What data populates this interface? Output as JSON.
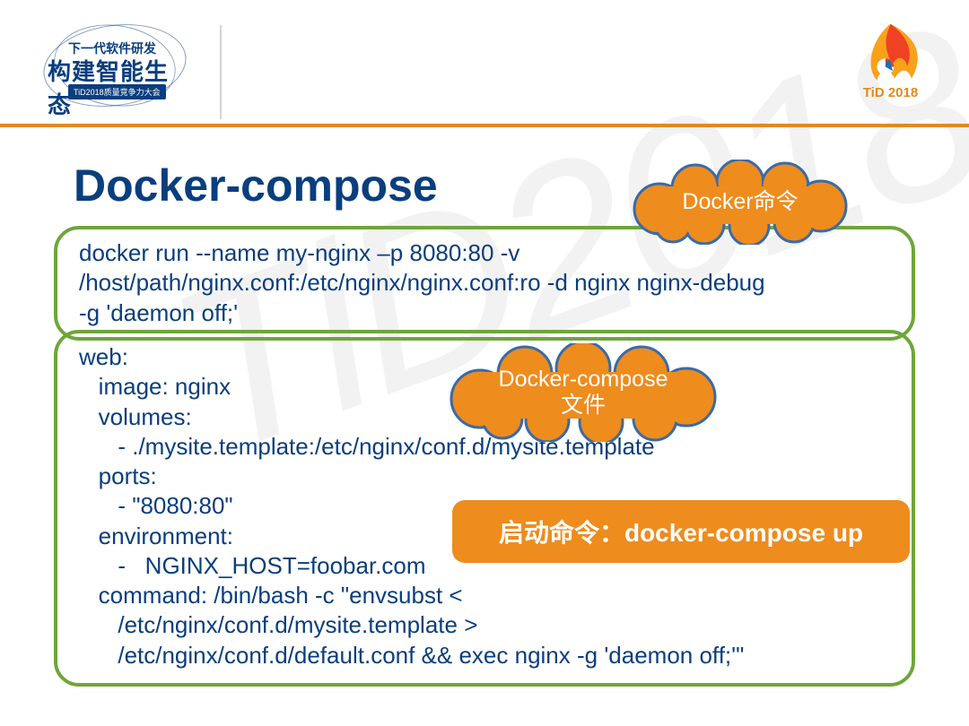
{
  "watermark": "TiD2018",
  "header": {
    "logo_top": "下一代软件研发",
    "logo_main": "构建智能生态",
    "logo_ribbon": "TiD2018质量竞争力大会",
    "tid_label": "TiD 2018"
  },
  "title": "Docker-compose",
  "cloud1": "Docker命令",
  "cloud2_line1": "Docker-compose",
  "cloud2_line2": "文件",
  "box1": {
    "l1": "docker run --name my-nginx –p 8080:80 -v",
    "l2": "/host/path/nginx.conf:/etc/nginx/nginx.conf:ro -d nginx nginx-debug",
    "l3": "-g 'daemon off;'"
  },
  "box2": {
    "l1": "web:",
    "l2": "   image: nginx",
    "l3": "   volumes:",
    "l4": "      - ./mysite.template:/etc/nginx/conf.d/mysite.template",
    "l5": "   ports:",
    "l6": "      - \"8080:80\"",
    "l7": "   environment:",
    "l8": "      -   NGINX_HOST=foobar.com",
    "l9": "   command: /bin/bash -c \"envsubst <",
    "l10": "      /etc/nginx/conf.d/mysite.template >",
    "l11": "      /etc/nginx/conf.d/default.conf && exec nginx -g 'daemon off;'\""
  },
  "pill": "启动命令：docker-compose up"
}
